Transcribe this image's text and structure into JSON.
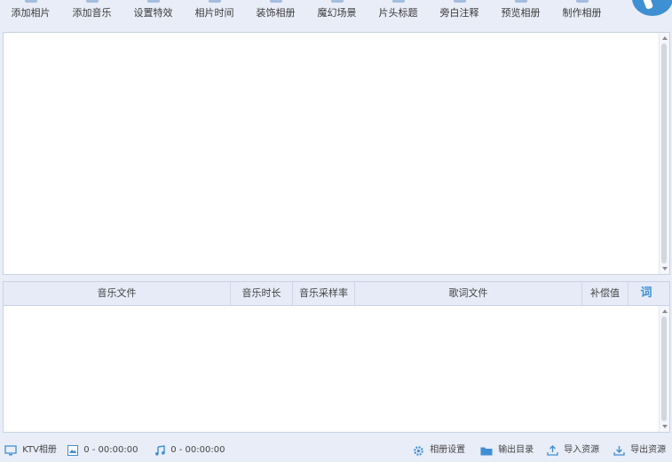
{
  "toolbar": {
    "items": [
      {
        "label": "添加相片"
      },
      {
        "label": "添加音乐"
      },
      {
        "label": "设置特效"
      },
      {
        "label": "相片时间"
      },
      {
        "label": "装饰相册"
      },
      {
        "label": "魔幻场景"
      },
      {
        "label": "片头标题"
      },
      {
        "label": "旁白注释"
      },
      {
        "label": "预览相册"
      },
      {
        "label": "制作相册"
      }
    ]
  },
  "music_table": {
    "columns": [
      {
        "label": "音乐文件"
      },
      {
        "label": "音乐时长"
      },
      {
        "label": "音乐采样率"
      },
      {
        "label": "歌词文件"
      },
      {
        "label": "补偿值"
      },
      {
        "label": "词"
      }
    ]
  },
  "statusbar": {
    "album_type": "KTV相册",
    "photo_time": "0 - 00:00:00",
    "music_time": "0 - 00:00:00",
    "album_settings": "相册设置",
    "output_dir": "输出目录",
    "import_resources": "导入资源",
    "export_resources": "导出资源"
  },
  "colors": {
    "accent": "#3f8fd3",
    "toolbar_bg": "#e9edf8",
    "header_bg": "#e6ebf7",
    "panel_bg": "#ffffff"
  }
}
